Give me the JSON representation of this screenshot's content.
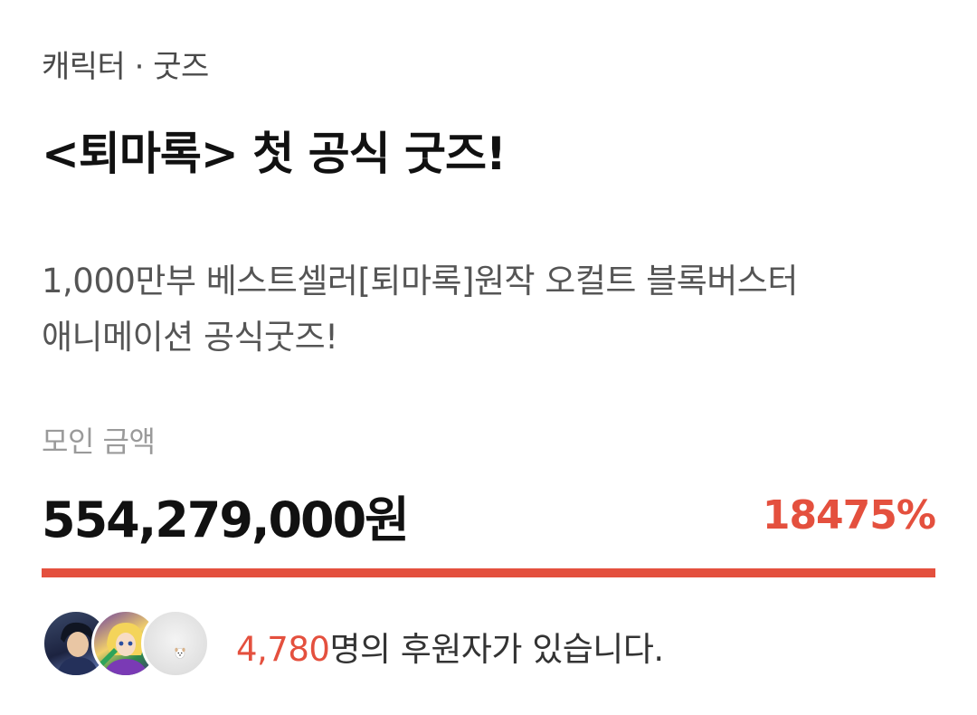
{
  "project": {
    "category": "캐릭터 · 굿즈",
    "title": "<퇴마록> 첫 공식 굿즈!",
    "description_line1": "1,000만부 베스트셀러[퇴마록]원작 오컬트 블록버스터",
    "description_line2": "애니메이션 공식굿즈!"
  },
  "funding": {
    "amount_label": "모인 금액",
    "amount": "554,279,000원",
    "percent": "18475%",
    "progress_fill": 1.0,
    "accent_color": "#e4503e"
  },
  "backers": {
    "count": "4,780",
    "suffix": "명의 후원자가 있습니다.",
    "avatars": [
      "avatar-1",
      "avatar-2",
      "avatar-3"
    ]
  }
}
